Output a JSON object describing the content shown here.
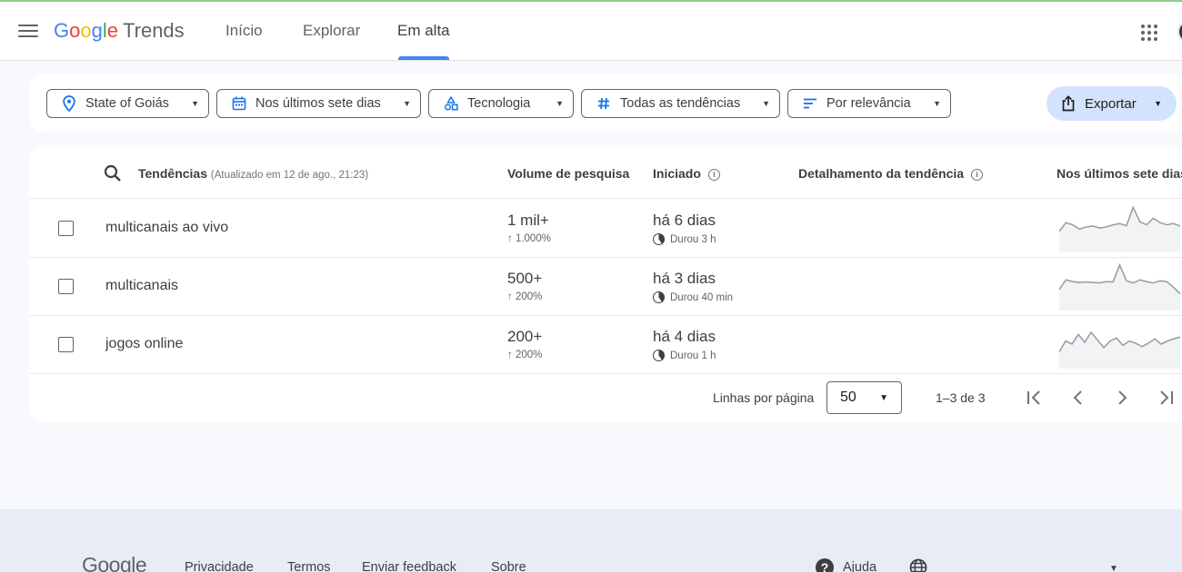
{
  "app": {
    "logo_letters": [
      "G",
      "o",
      "o",
      "g",
      "l",
      "e"
    ],
    "logo_product": "Trends"
  },
  "nav": {
    "tabs": [
      {
        "label": "Início",
        "active": false
      },
      {
        "label": "Explorar",
        "active": false
      },
      {
        "label": "Em alta",
        "active": true
      }
    ]
  },
  "filters": {
    "location": "State of Goiás",
    "period": "Nos últimos sete dias",
    "category": "Tecnologia",
    "trend_type": "Todas as tendências",
    "sort": "Por relevância",
    "export": "Exportar"
  },
  "table": {
    "headers": {
      "trends": "Tendências",
      "updated": "(Atualizado em 12 de ago., 21:23)",
      "volume": "Volume de pesquisa",
      "started": "Iniciado",
      "breakdown": "Detalhamento da tendência",
      "last7": "Nos últimos sete dias"
    },
    "rows": [
      {
        "term": "multicanais ao vivo",
        "volume": "1 mil+",
        "growth": "↑ 1.000%",
        "started": "há 6 dias",
        "duration": "Durou 3 h",
        "spark": [
          40,
          60,
          55,
          45,
          50,
          52,
          48,
          50,
          55,
          58,
          53,
          95,
          62,
          55,
          70,
          60,
          55,
          58,
          52
        ]
      },
      {
        "term": "multicanais",
        "volume": "500+",
        "growth": "↑ 200%",
        "started": "há 3 dias",
        "duration": "Durou 40 min",
        "spark": [
          40,
          62,
          58,
          56,
          57,
          56,
          55,
          58,
          57,
          96,
          60,
          55,
          62,
          58,
          55,
          60,
          58,
          45,
          30
        ]
      },
      {
        "term": "jogos online",
        "volume": "200+",
        "growth": "↑ 200%",
        "started": "há 4 dias",
        "duration": "Durou 1 h",
        "spark": [
          30,
          55,
          48,
          70,
          52,
          75,
          58,
          40,
          55,
          62,
          45,
          55,
          50,
          42,
          50,
          60,
          48,
          55,
          60,
          64
        ]
      }
    ]
  },
  "pagination": {
    "rows_label": "Linhas por página",
    "rows_value": "50",
    "range": "1–3 de 3"
  },
  "footer": {
    "logo": "Google",
    "links": [
      "Privacidade",
      "Termos",
      "Enviar feedback",
      "Sobre"
    ],
    "help": "Ajuda"
  },
  "colors": {
    "accent": "#4285f4",
    "export_bg": "#d3e3fd",
    "sparkline": "#9aa0a6"
  }
}
